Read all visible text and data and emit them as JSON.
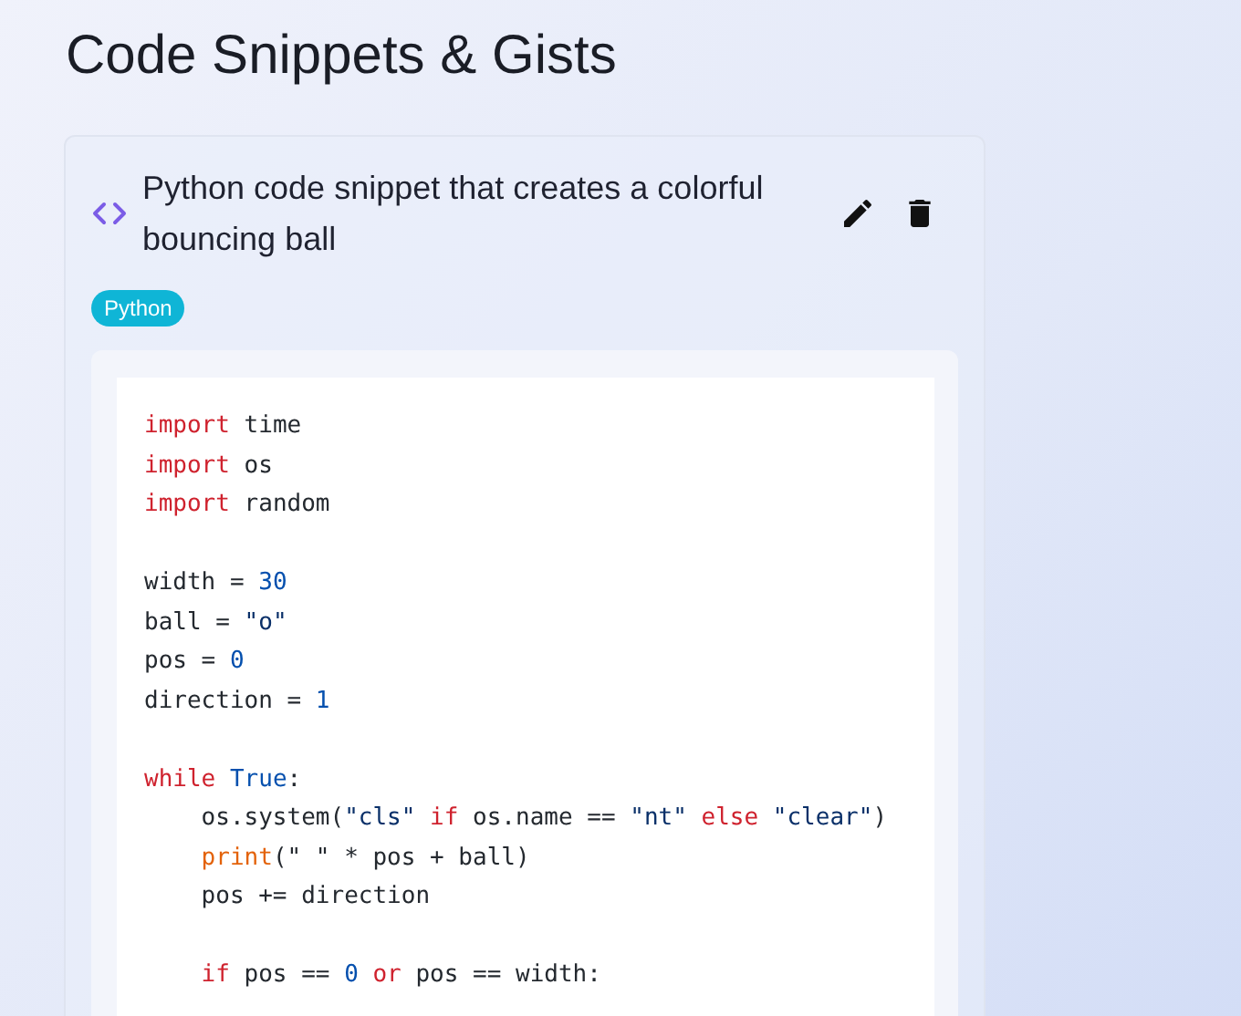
{
  "page": {
    "title": "Code Snippets & Gists"
  },
  "snippet": {
    "title": "Python code snippet that creates a colorful bouncing ball",
    "tags": [
      {
        "label": "Python",
        "color": "#0fb5d6"
      }
    ],
    "code_blocks": [
      [
        {
          "indented": false,
          "tokens": [
            {
              "kind": "keyword",
              "text": "import "
            },
            {
              "kind": "plain",
              "text": "time"
            }
          ]
        },
        {
          "indented": false,
          "tokens": [
            {
              "kind": "keyword",
              "text": "import "
            },
            {
              "kind": "plain",
              "text": "os"
            }
          ]
        },
        {
          "indented": false,
          "tokens": [
            {
              "kind": "keyword",
              "text": "import "
            },
            {
              "kind": "plain",
              "text": "random"
            }
          ]
        }
      ],
      [
        {
          "indented": false,
          "tokens": [
            {
              "kind": "plain",
              "text": "width = "
            },
            {
              "kind": "number",
              "text": "30"
            }
          ]
        },
        {
          "indented": false,
          "tokens": [
            {
              "kind": "plain",
              "text": "ball = "
            },
            {
              "kind": "string",
              "text": "\"o\""
            }
          ]
        },
        {
          "indented": false,
          "tokens": [
            {
              "kind": "plain",
              "text": "pos = "
            },
            {
              "kind": "number",
              "text": "0"
            }
          ]
        },
        {
          "indented": false,
          "tokens": [
            {
              "kind": "plain",
              "text": "direction = "
            },
            {
              "kind": "number",
              "text": "1"
            }
          ]
        }
      ],
      [
        {
          "indented": false,
          "tokens": [
            {
              "kind": "keyword",
              "text": "while "
            },
            {
              "kind": "constant",
              "text": "True"
            },
            {
              "kind": "plain",
              "text": ":"
            }
          ]
        },
        {
          "indented": true,
          "tokens": [
            {
              "kind": "plain",
              "text": "os.system("
            },
            {
              "kind": "string",
              "text": "\"cls\" "
            },
            {
              "kind": "keyword",
              "text": "if "
            },
            {
              "kind": "plain",
              "text": "os.name == "
            },
            {
              "kind": "string",
              "text": "\"nt\" "
            },
            {
              "kind": "keyword",
              "text": "else "
            },
            {
              "kind": "string",
              "text": "\"clear\""
            },
            {
              "kind": "plain",
              "text": ")"
            }
          ]
        },
        {
          "indented": true,
          "tokens": [
            {
              "kind": "builtin",
              "text": "print"
            },
            {
              "kind": "plain",
              "text": "(\" \" * pos + ball)"
            }
          ]
        },
        {
          "indented": true,
          "tokens": [
            {
              "kind": "plain",
              "text": "pos += direction"
            }
          ]
        }
      ],
      [
        {
          "indented": true,
          "tokens": [
            {
              "kind": "keyword",
              "text": "if "
            },
            {
              "kind": "plain",
              "text": "pos == "
            },
            {
              "kind": "number",
              "text": "0 "
            },
            {
              "kind": "keyword",
              "text": "or "
            },
            {
              "kind": "plain",
              "text": "pos == width:"
            }
          ]
        }
      ]
    ]
  }
}
